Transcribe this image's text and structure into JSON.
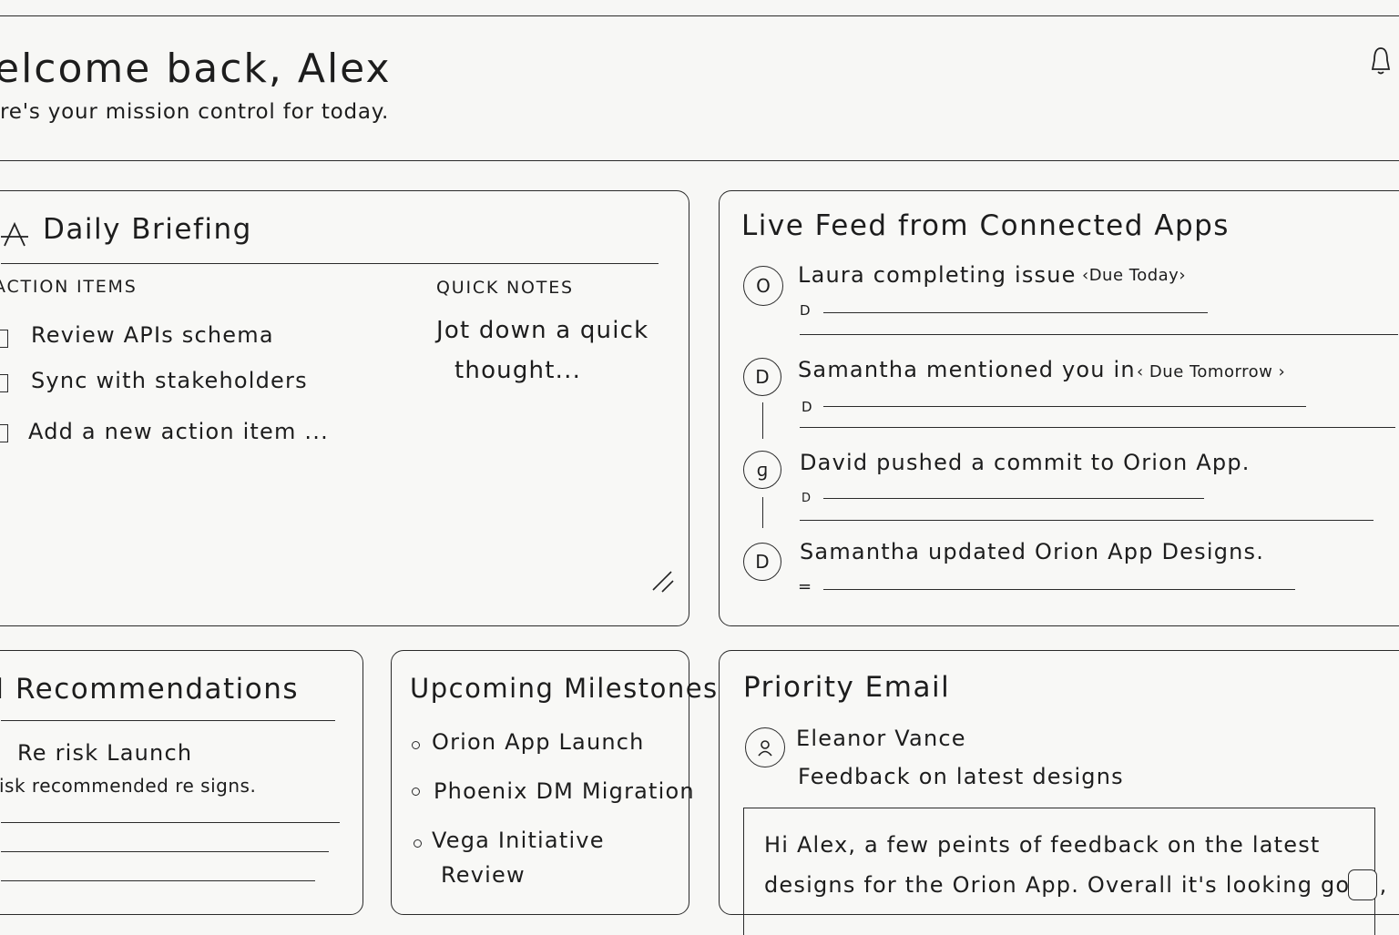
{
  "header": {
    "title": "elcome back, Alex",
    "subtitle": "re's your mission control for today."
  },
  "briefing": {
    "title": "Daily Briefing",
    "action_items_label": "ACTION ITEMS",
    "quick_notes_label": "QUICK NOTES",
    "action_items": [
      "Review APIs schema",
      "Sync with stakeholders"
    ],
    "add_item_placeholder": "Add a new action item ...",
    "notes_line1": "Jot down a quick",
    "notes_line2": "thought..."
  },
  "feed": {
    "title": "Live Feed from Connected Apps",
    "items": [
      {
        "avatar": "O",
        "text": "Laura completing issue",
        "tag": "‹Due Today›",
        "meta": "D"
      },
      {
        "avatar": "D",
        "text": "Samantha mentioned you  in",
        "tag": "‹ Due Tomorrow ›",
        "meta": "D"
      },
      {
        "avatar": "ɡ",
        "text": "David pushed a commit to Orion App.",
        "tag": "",
        "meta": "D"
      },
      {
        "avatar": "D",
        "text": "Samantha updated Orion App Designs.",
        "tag": "",
        "meta": "="
      }
    ]
  },
  "ai": {
    "title": "I Recommendations",
    "line1": "Re risk  Launch",
    "line2": "isk recommended re signs."
  },
  "milestones": {
    "title": "Upcoming Milestones",
    "items": [
      "Orion App Launch",
      "Phoenix DM Migration",
      "Vega Initiative"
    ],
    "item3_cont": "Review"
  },
  "email": {
    "title": "Priority Email",
    "sender": "Eleanor Vance",
    "subject": "Feedback on latest designs",
    "body1": "Hi Alex, a few peints of feedback on the latest",
    "body2": "designs for the Orion App. Overall it's looking good,"
  },
  "icons": {
    "bell": "bell-icon",
    "briefing": "briefing-icon",
    "resize": "resize-handle-icon",
    "person": "person-icon"
  }
}
